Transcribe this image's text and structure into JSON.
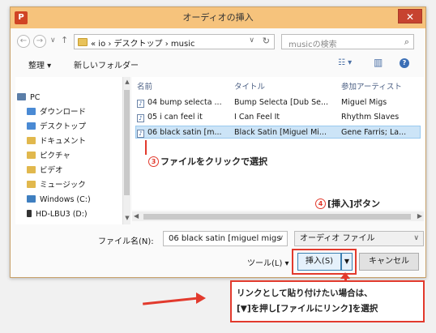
{
  "window": {
    "title": "オーディオの挿入",
    "app_icon": "P",
    "close_glyph": "✕"
  },
  "address_bar": {
    "back_glyph": "←",
    "forward_glyph": "→",
    "recent_glyph": "∨",
    "up_glyph": "↑",
    "path": "« io › デスクトップ › music",
    "dropdown_glyph": "∨",
    "refresh_glyph": "↻",
    "search_placeholder": "musicの検索",
    "search_glyph": "⌕"
  },
  "toolbar": {
    "organize": "整理 ▾",
    "new_folder": "新しいフォルダー",
    "view_glyph": "☷ ▾",
    "pane_glyph": "▥",
    "help_glyph": "?"
  },
  "sidebar": {
    "items": [
      {
        "label": "PC",
        "color": "#5b7ea8"
      },
      {
        "label": "ダウンロード",
        "color": "#4a8ad4"
      },
      {
        "label": "デスクトップ",
        "color": "#4a8ad4"
      },
      {
        "label": "ドキュメント",
        "color": "#e1b84d"
      },
      {
        "label": "ピクチャ",
        "color": "#e1b84d"
      },
      {
        "label": "ビデオ",
        "color": "#e1b84d"
      },
      {
        "label": "ミュージック",
        "color": "#e1b84d"
      },
      {
        "label": "Windows (C:)",
        "color": "#3f7fc0"
      },
      {
        "label": "HD-LBU3 (D:)",
        "color": "#333333"
      }
    ]
  },
  "file_list": {
    "columns": [
      "名前",
      "タイトル",
      "参加アーティスト"
    ],
    "rows": [
      {
        "name": "04 bump selecta ...",
        "title": "Bump Selecta [Dub Se...",
        "artist": "Miguel Migs"
      },
      {
        "name": "05 i can feel it",
        "title": "I Can Feel It",
        "artist": "Rhythm Slaves"
      },
      {
        "name": "06 black satin [m...",
        "title": "Black Satin [Miguel Mi...",
        "artist": "Gene Farris; La..."
      }
    ],
    "selected_index": 2
  },
  "form": {
    "filename_label": "ファイル名(N):",
    "filename_value": "06 black satin [miguel migs",
    "filetype_value": "オーディオ ファイル",
    "dropdown_glyph": "∨",
    "tools_label": "ツール(L)  ▾",
    "insert_label": "挿入(S)",
    "insert_drop_glyph": "▼",
    "cancel_label": "キャンセル"
  },
  "annotations": {
    "step3_num": "3",
    "step3_text": "ファイルをクリックで選択",
    "step4_num": "4",
    "step4_text": "[挿入]ボタン",
    "callout_line1": "リンクとして貼り付けたい場合は、",
    "callout_line2": "[▼]を押し[ファイルにリンク]を選択",
    "accent_color": "#e23a2d"
  }
}
